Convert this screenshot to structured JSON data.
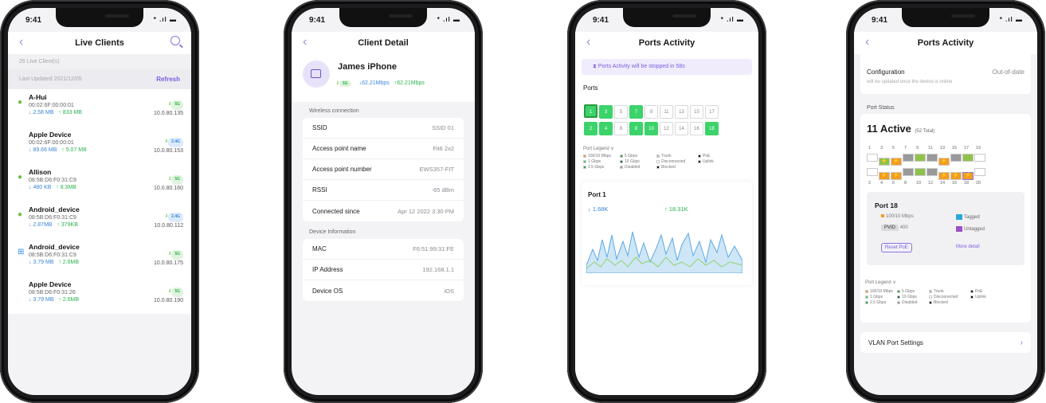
{
  "status": {
    "time": "9:41",
    "signal": "* .ıl ▬"
  },
  "screen1": {
    "title": "Live Clients",
    "count": "26 Live Client(s)",
    "last_updated": "Last Updated 2021/12/05",
    "refresh": "Refresh",
    "clients": [
      {
        "name": "A-Hui",
        "mac": "00:02:6F:00:00:01",
        "down": "↓ 2.58 MB",
        "up": "↑ 833 MB",
        "band": "5G",
        "ip": "10.0.80.135",
        "os": "android"
      },
      {
        "name": "Apple Device",
        "mac": "00:02:6F:00:00:01",
        "down": "↓ 89.66 MB",
        "up": "↑ 5.07 MB",
        "band": "2.4G",
        "ip": "10.0.80.153",
        "os": "apple"
      },
      {
        "name": "Allison",
        "mac": "08:5B:D6:F0:31:C9",
        "down": "↓ 480 KB",
        "up": "↑ 8.3MB",
        "band": "5G",
        "ip": "10.0.80.160",
        "os": "android"
      },
      {
        "name": "Android_device",
        "mac": "08:5B:D6:F0:31:C9",
        "down": "↓ 2.87MB",
        "up": "↑ 379KB",
        "band": "2.4G",
        "ip": "10.0.80.112",
        "os": "android"
      },
      {
        "name": "Android_device",
        "mac": "08:5B:D6:F0:31:C9",
        "down": "↓ 3.79 MB",
        "up": "↑ 2.6MB",
        "band": "5G",
        "ip": "10.0.80.175",
        "os": "windows"
      },
      {
        "name": "Apple Device",
        "mac": "08:5B:D6:F0:31:26",
        "down": "↓ 3.79 MB",
        "up": "↑ 2.6MB",
        "band": "5G",
        "ip": "10.0.80.190",
        "os": "apple"
      }
    ]
  },
  "screen2": {
    "title": "Client Detail",
    "device_name": "James iPhone",
    "band": "5G",
    "down": "↓62.21Mbps",
    "up": "↑62.21Mbps",
    "wireless_header": "Wireless connection",
    "wireless": [
      {
        "label": "SSID",
        "value": "SSID 01"
      },
      {
        "label": "Access point name",
        "value": "Fit6 2x2"
      },
      {
        "label": "Access point number",
        "value": "EWS357-FIT"
      },
      {
        "label": "RSSI",
        "value": "-65 dBm"
      },
      {
        "label": "Connected since",
        "value": "Apr 12 2022 3:30 PM"
      }
    ],
    "device_header": "Device Information",
    "device": [
      {
        "label": "MAC",
        "value": "F6:51:99:31:FE"
      },
      {
        "label": "IP Address",
        "value": "192.168.1.1"
      },
      {
        "label": "Device OS",
        "value": "iOS"
      }
    ]
  },
  "screen3": {
    "title": "Ports Activity",
    "banner": "Ports Activity will be stopped in 58s",
    "ports_label": "Ports",
    "top_ports": [
      "1",
      "3",
      "5",
      "7",
      "9",
      "11",
      "13",
      "15",
      "17"
    ],
    "bottom_ports": [
      "2",
      "4",
      "6",
      "8",
      "10",
      "12",
      "14",
      "16",
      "18"
    ],
    "legend_title": "Port Legend ∨",
    "legend": [
      "100/10 Mbps",
      "5 Gbps",
      "Trunk",
      "PoE",
      "1 Gbps",
      "10 Gbps",
      "Disconnected",
      "Uplink",
      "2.5 Gbps",
      "Disabled",
      "Blocked"
    ],
    "port_name": "Port 1",
    "down": "↓ 1.68K",
    "up": "↑ 18.31K"
  },
  "screen4": {
    "title": "Ports Activity",
    "config_label": "Configuration",
    "config_value": "Out-of-date",
    "config_note": "will be updated once the device is online",
    "port_status": "Port Status",
    "active": "11 Active",
    "total": "(52 Total)",
    "top_nums": [
      "1",
      "3",
      "5",
      "7",
      "9",
      "11",
      "13",
      "15",
      "17",
      "19"
    ],
    "bottom_nums": [
      "2",
      "4",
      "6",
      "8",
      "10",
      "12",
      "14",
      "16",
      "18",
      "20"
    ],
    "port_title": "Port 18",
    "speed": "100/10 Mbps",
    "pvid_label": "PVID",
    "pvid_value": "400",
    "tagged": "Tagged",
    "untagged": "Untagged",
    "reset": "Reset PoE",
    "more": "More detail",
    "legend_title": "Port Legend ∨",
    "vlan": "VLAN Port Settings"
  },
  "colors": {
    "accent": "#7d5ce0",
    "green": "#3bd36a",
    "orange": "#f59b1e"
  }
}
